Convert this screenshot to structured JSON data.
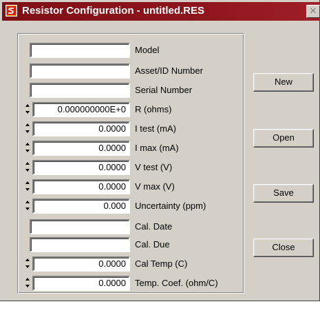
{
  "window": {
    "title": "Resistor Configuration - untitled.RES",
    "close_symbol": "✕",
    "icon": "red-s-app-icon"
  },
  "fields": [
    {
      "label": "Model",
      "value": "",
      "spinner": false
    },
    {
      "label": "Asset/ID Number",
      "value": "",
      "spinner": false
    },
    {
      "label": "Serial Number",
      "value": "",
      "spinner": false
    },
    {
      "label": "R (ohms)",
      "value": "0.000000000E+0",
      "spinner": true
    },
    {
      "label": "I test (mA)",
      "value": "0.0000",
      "spinner": true
    },
    {
      "label": "I max (mA)",
      "value": "0.0000",
      "spinner": true
    },
    {
      "label": "V test (V)",
      "value": "0.0000",
      "spinner": true
    },
    {
      "label": "V max (V)",
      "value": "0.0000",
      "spinner": true
    },
    {
      "label": "Uncertainty (ppm)",
      "value": "0.000",
      "spinner": true
    },
    {
      "label": "Cal. Date",
      "value": "",
      "spinner": false
    },
    {
      "label": "Cal. Due",
      "value": "",
      "spinner": false
    },
    {
      "label": "Cal Temp (C)",
      "value": "0.0000",
      "spinner": true
    },
    {
      "label": "Temp. Coef. (ohm/C)",
      "value": "0.0000",
      "spinner": true
    }
  ],
  "buttons": {
    "new": "New",
    "open": "Open",
    "save": "Save",
    "close": "Close"
  },
  "colors": {
    "titlebar": "#8d141c",
    "face": "#d4d0c8"
  }
}
